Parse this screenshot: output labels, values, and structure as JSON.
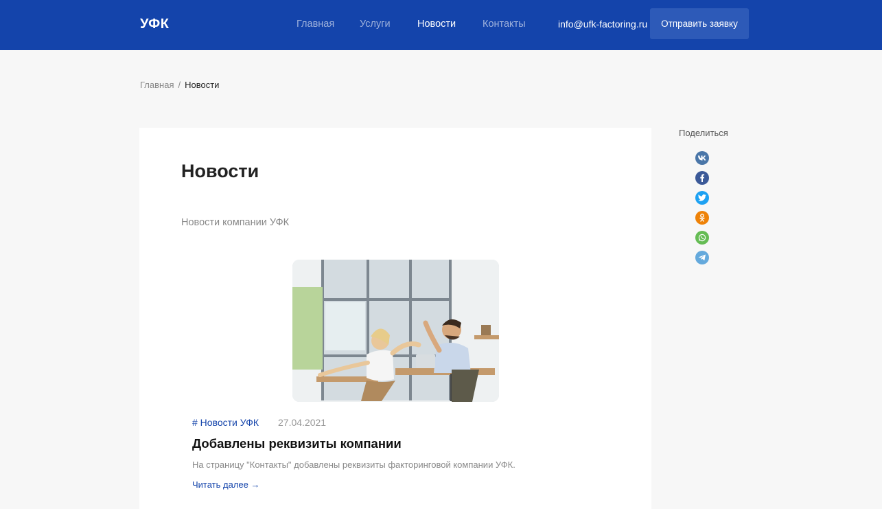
{
  "header": {
    "logo": "УФК",
    "nav": [
      "Главная",
      "Услуги",
      "Новости",
      "Контакты"
    ],
    "email": "info@ufk-factoring.ru",
    "cta_label": "Отправить заявку"
  },
  "breadcrumb": {
    "home": "Главная",
    "separator": "/",
    "current": "Новости"
  },
  "main": {
    "title": "Новости",
    "subtitle": "Новости компании УФК",
    "news": [
      {
        "tag": "# Новости УФК",
        "date": "27.04.2021",
        "title": "Добавлены реквизиты компании",
        "description": "На страницу \"Контакты\" добавлены реквизиты факторинговой компании УФК.",
        "read_more": "Читать далее →",
        "image_alt": "photo-two-colleagues-high-five-office"
      }
    ]
  },
  "share": {
    "label": "Поделиться",
    "buttons": [
      {
        "icon": "vk-icon",
        "color": "#4a76a8"
      },
      {
        "icon": "facebook-icon",
        "color": "#3b5998"
      },
      {
        "icon": "twitter-icon",
        "color": "#1da1f2"
      },
      {
        "icon": "odnoklassniki-icon",
        "color": "#ee8208"
      },
      {
        "icon": "whatsapp-icon",
        "color": "#65bc54"
      },
      {
        "icon": "telegram-icon",
        "color": "#64a9dc"
      }
    ]
  },
  "colors": {
    "brand": "#1444ab",
    "page_bg": "#f7f7f7",
    "card_bg": "#ffffff"
  }
}
